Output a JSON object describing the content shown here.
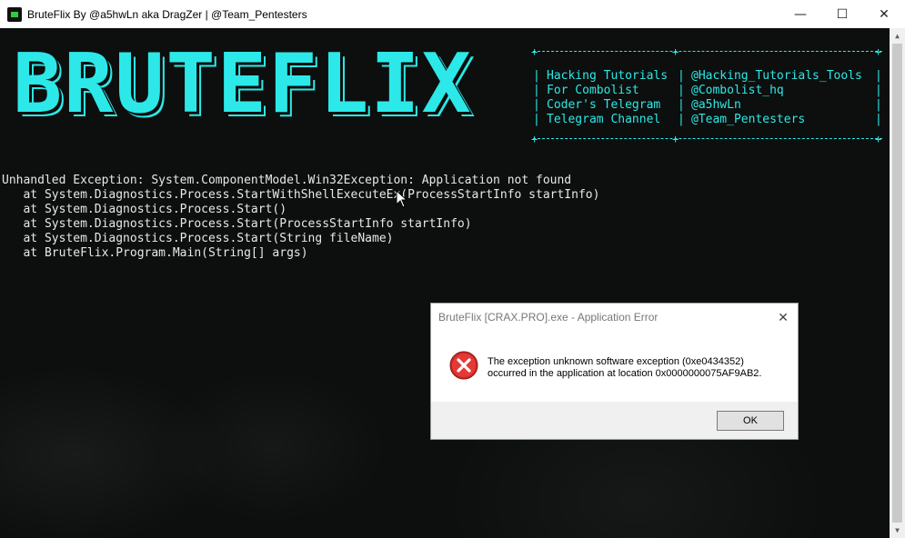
{
  "window": {
    "title": "BruteFlix By @a5hwLn aka DragZer | @Team_Pentesters",
    "minimize_glyph": "—",
    "maximize_glyph": "☐",
    "close_glyph": "✕"
  },
  "console": {
    "logo_text": "BRUTEFLIX",
    "info_rows": [
      {
        "left": "Hacking Tutorials",
        "right": "@Hacking_Tutorials_Tools"
      },
      {
        "left": "For Combolist",
        "right": "@Combolist_hq"
      },
      {
        "left": "Coder's Telegram",
        "right": "@a5hwLn"
      },
      {
        "left": "Telegram Channel",
        "right": "@Team_Pentesters"
      }
    ],
    "exception_lines": [
      "Unhandled Exception: System.ComponentModel.Win32Exception: Application not found",
      "   at System.Diagnostics.Process.StartWithShellExecuteEx(ProcessStartInfo startInfo)",
      "   at System.Diagnostics.Process.Start()",
      "   at System.Diagnostics.Process.Start(ProcessStartInfo startInfo)",
      "   at System.Diagnostics.Process.Start(String fileName)",
      "   at BruteFlix.Program.Main(String[] args)"
    ]
  },
  "dialog": {
    "title": "BruteFlix [CRAX.PRO].exe - Application Error",
    "close_glyph": "✕",
    "message_line1": "The exception unknown software exception (0xe0434352)",
    "message_line2": "occurred in the application at location 0x0000000075AF9AB2.",
    "ok_label": "OK"
  },
  "colors": {
    "accent": "#2de8e8",
    "console_bg": "#0c0f0e",
    "error_red": "#d32f2f"
  }
}
